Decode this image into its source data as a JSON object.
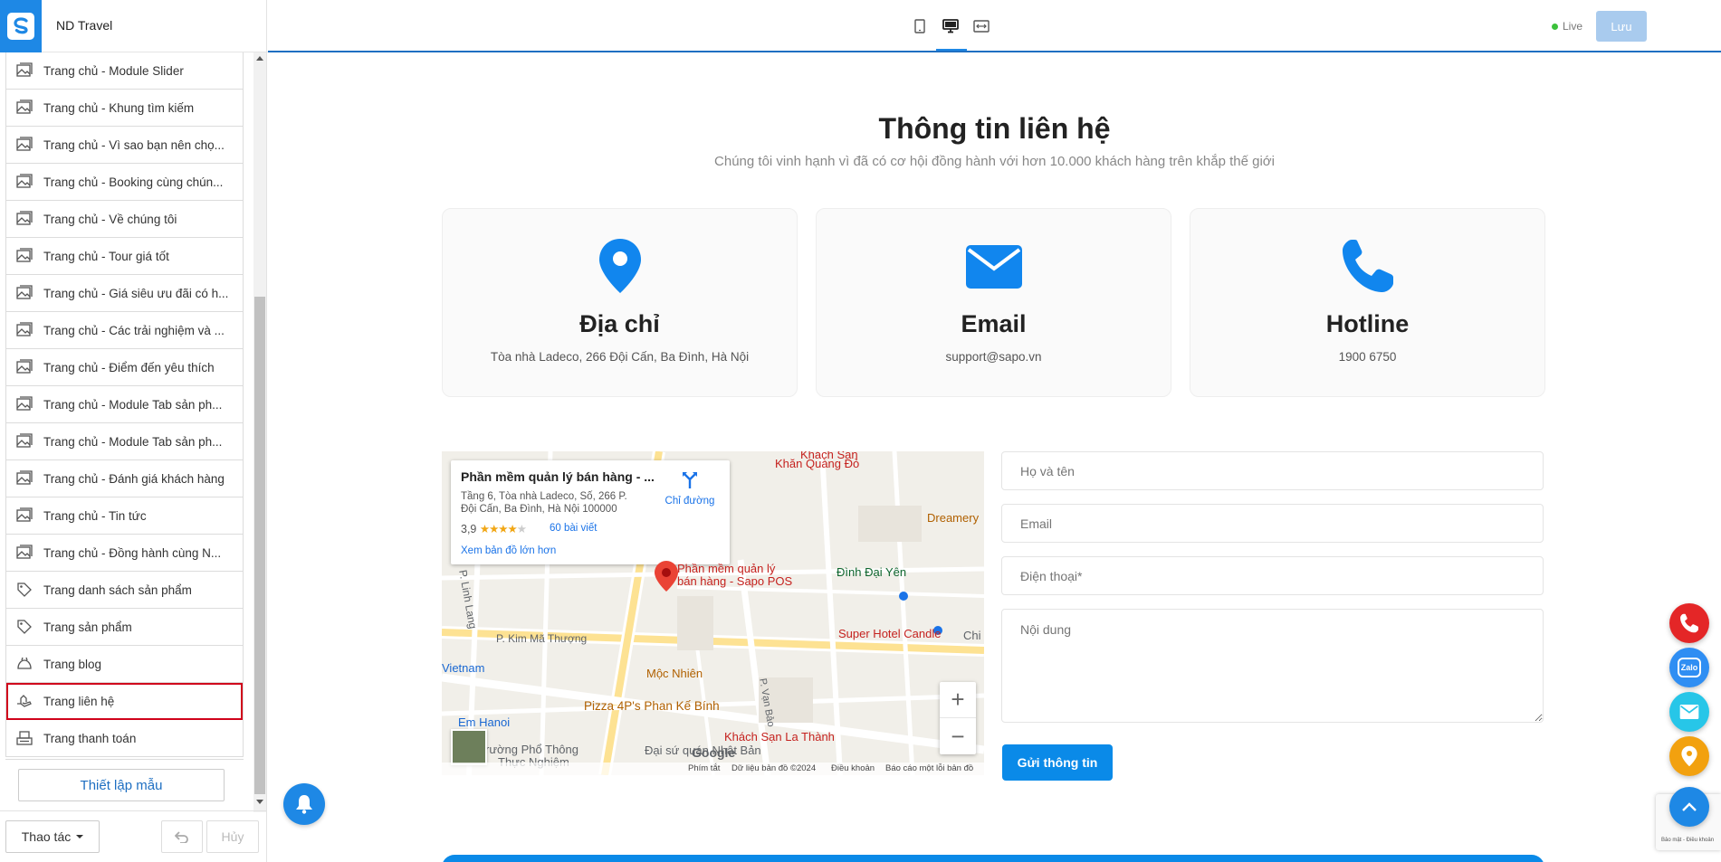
{
  "header": {
    "store_name": "ND Travel",
    "live_label": "Live",
    "save_label": "Lưu"
  },
  "sidebar": {
    "items": [
      {
        "label": "Trang chủ - Module Slider",
        "icon": "image-icon"
      },
      {
        "label": "Trang chủ - Khung tìm kiếm",
        "icon": "image-icon"
      },
      {
        "label": "Trang chủ - Vì sao bạn nên chọ...",
        "icon": "image-icon"
      },
      {
        "label": "Trang chủ - Booking cùng chún...",
        "icon": "image-icon"
      },
      {
        "label": "Trang chủ - Về chúng tôi",
        "icon": "image-icon"
      },
      {
        "label": "Trang chủ - Tour giá tốt",
        "icon": "image-icon"
      },
      {
        "label": "Trang chủ - Giá siêu ưu đãi có h...",
        "icon": "image-icon"
      },
      {
        "label": "Trang chủ - Các trải nghiệm và ...",
        "icon": "image-icon"
      },
      {
        "label": "Trang chủ - Điểm đến yêu thích",
        "icon": "image-icon"
      },
      {
        "label": "Trang chủ - Module Tab sản ph...",
        "icon": "image-icon"
      },
      {
        "label": "Trang chủ - Module Tab sản ph...",
        "icon": "image-icon"
      },
      {
        "label": "Trang chủ - Đánh giá khách hàng",
        "icon": "image-icon"
      },
      {
        "label": "Trang chủ - Tin tức",
        "icon": "image-icon"
      },
      {
        "label": "Trang chủ - Đồng hành cùng N...",
        "icon": "image-icon"
      },
      {
        "label": "Trang danh sách sản phẩm",
        "icon": "tag-icon"
      },
      {
        "label": "Trang sản phẩm",
        "icon": "tag-icon"
      },
      {
        "label": "Trang blog",
        "icon": "blog-icon"
      },
      {
        "label": "Trang liên hệ",
        "icon": "contact-hand-icon"
      },
      {
        "label": "Trang thanh toán",
        "icon": "checkout-icon"
      }
    ],
    "active_label": "Trang liên hệ",
    "setup_label": "Thiết lập mẫu",
    "action_label": "Thao tác",
    "redo_label": "Hủy"
  },
  "contact": {
    "title": "Thông tin liên hệ",
    "subtitle": "Chúng tôi vinh hạnh vì đã có cơ hội đồng hành với hơn 10.000 khách hàng trên khắp thế giới",
    "cards": [
      {
        "title": "Địa chỉ",
        "text": "Tòa nhà Ladeco, 266 Đội Cấn, Ba Đình, Hà Nội",
        "icon": "map-pin-icon"
      },
      {
        "title": "Email",
        "text": "support@sapo.vn",
        "icon": "envelope-icon"
      },
      {
        "title": "Hotline",
        "text": "1900 6750",
        "icon": "phone-icon"
      }
    ]
  },
  "map": {
    "info_title": "Phần mềm quản lý bán hàng - ...",
    "info_address": "Tầng 6, Tòa nhà Ladeco, Số, 266 P. Đội Cấn, Ba Đình, Hà Nội 100000",
    "rating": "3,9",
    "stars": "★★★★",
    "star_empty": "★",
    "reviews": "60 bài viết",
    "larger_map": "Xem bản đồ lớn hơn",
    "directions": "Chỉ đường",
    "labels": {
      "place": "Phần mềm quản lý",
      "place2": "bán hàng - Sapo POS",
      "khach_san": "Khách Sạn",
      "khan_quang": "Khăn Quàng Đỏ",
      "dreamery": "Dreamery",
      "dinh_dai_yen": "Đình Đại Yên",
      "super_hotel": "Super Hotel Candle",
      "kim_ma": "P. Kim Mã Thượng",
      "linh_lang": "P. Linh Lang",
      "vietnam": "Vietnam",
      "moc_nhien": "Mộc Nhiên",
      "pizza": "Pizza 4P's Phan Kế Bính",
      "van_bao": "P. Vạn Bảo",
      "em_hanoi": "Em Hanoi",
      "la_thanh": "Khách Sạn La Thành",
      "truong": "rường Phổ Thông",
      "thuc_nghiem": "Thực Nghiệm",
      "dai_su": "Đại sứ quán Nhật Bản",
      "chi": "Chi"
    },
    "zoom_in": "+",
    "zoom_out": "−",
    "google": "Google",
    "footer": {
      "shortcuts": "Phím tắt",
      "data": "Dữ liệu bản đồ ©2024",
      "terms": "Điều khoản",
      "report": "Báo cáo một lỗi bản đồ"
    }
  },
  "form": {
    "name_placeholder": "Họ và tên",
    "email_placeholder": "Email",
    "phone_placeholder": "Điện thoại*",
    "content_placeholder": "Nội dung",
    "submit_label": "Gửi thông tin"
  },
  "floating": {
    "zalo_label": "Zalo",
    "recaptcha_text": "Bảo mật - Điều khoản"
  },
  "colors": {
    "primary": "#0a8ae8",
    "icon_blue": "#1186ee",
    "call_red": "#e42627",
    "zalo_blue": "#2f8ef3",
    "mail_cyan": "#27c6e8",
    "map_orange": "#f2a10f",
    "active_outline": "#d0021b"
  }
}
